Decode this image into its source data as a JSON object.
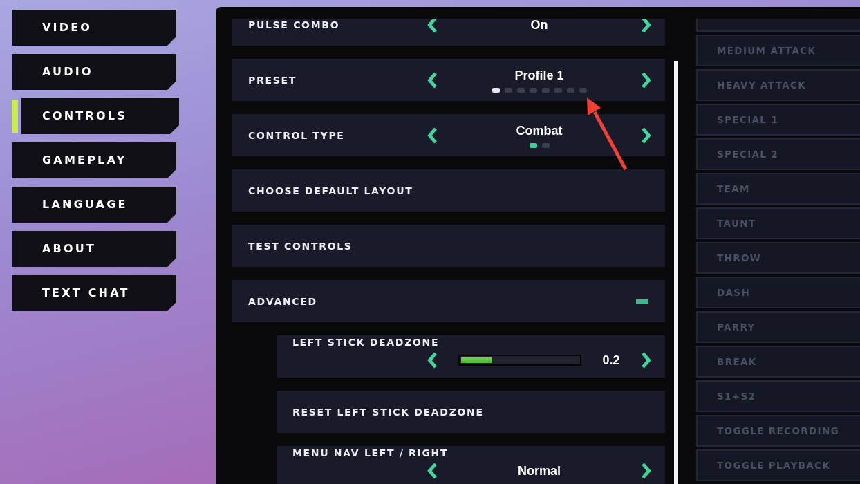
{
  "sidebar": {
    "items": [
      {
        "label": "VIDEO",
        "selected": false
      },
      {
        "label": "AUDIO",
        "selected": false
      },
      {
        "label": "CONTROLS",
        "selected": true
      },
      {
        "label": "GAMEPLAY",
        "selected": false
      },
      {
        "label": "LANGUAGE",
        "selected": false
      },
      {
        "label": "ABOUT",
        "selected": false
      },
      {
        "label": "TEXT CHAT",
        "selected": false
      }
    ]
  },
  "settings": {
    "rows": [
      {
        "kind": "selector",
        "label": "PULSE COMBO",
        "value": "On"
      },
      {
        "kind": "selector",
        "label": "PRESET",
        "value": "Profile 1",
        "dots": [
          {
            "color": "#e6e6ee"
          },
          {
            "color": "#3a3d4e"
          },
          {
            "color": "#3a3d4e"
          },
          {
            "color": "#3a3d4e"
          },
          {
            "color": "#3a3d4e"
          },
          {
            "color": "#3a3d4e"
          },
          {
            "color": "#3a3d4e"
          },
          {
            "color": "#3a3d4e"
          }
        ]
      },
      {
        "kind": "selector",
        "label": "CONTROL TYPE",
        "value": "Combat",
        "dots": [
          {
            "color": "#3ecf94"
          },
          {
            "color": "#3a3d4e"
          }
        ]
      },
      {
        "kind": "action",
        "label": "CHOOSE DEFAULT LAYOUT"
      },
      {
        "kind": "action",
        "label": "TEST CONTROLS"
      },
      {
        "kind": "group",
        "label": "ADVANCED",
        "expanded": true,
        "children": [
          {
            "kind": "slider",
            "label": "LEFT STICK DEADZONE",
            "level": 0.26,
            "reading": "0.2"
          },
          {
            "kind": "action",
            "label": "RESET LEFT STICK DEADZONE"
          },
          {
            "kind": "selector",
            "label": "MENU NAV LEFT / RIGHT",
            "value": "Normal"
          }
        ]
      }
    ]
  },
  "bindings": {
    "items": [
      {
        "label": "MEDIUM ATTACK",
        "disabled": true
      },
      {
        "label": "HEAVY ATTACK",
        "disabled": true
      },
      {
        "label": "SPECIAL 1",
        "disabled": true
      },
      {
        "label": "SPECIAL 2",
        "disabled": true
      },
      {
        "label": "TEAM",
        "disabled": true
      },
      {
        "label": "TAUNT",
        "disabled": true
      },
      {
        "label": "THROW",
        "disabled": true
      },
      {
        "label": "DASH",
        "disabled": true
      },
      {
        "label": "PARRY",
        "disabled": true
      },
      {
        "label": "BREAK",
        "disabled": true
      },
      {
        "label": "S1+S2",
        "disabled": true
      },
      {
        "label": "TOGGLE RECORDING",
        "disabled": true
      },
      {
        "label": "TOGGLE PLAYBACK",
        "disabled": true
      }
    ]
  }
}
